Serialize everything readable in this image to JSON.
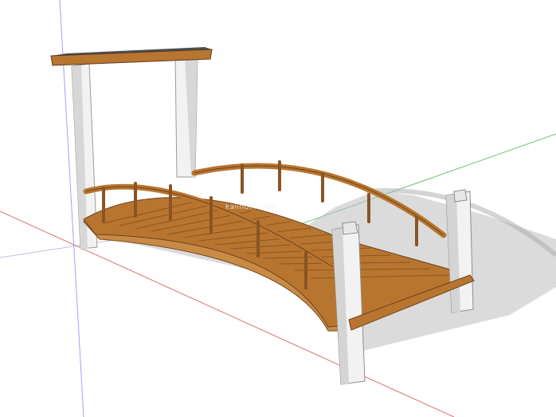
{
  "scene": {
    "watermark_text": "kalinom.com",
    "colors": {
      "background": "#ffffff",
      "wood_light": "#c88a45",
      "wood_mid": "#b8752f",
      "wood_dark": "#8a5423",
      "post_white": "#f2f2f2",
      "post_shade": "#cfcfcf",
      "shadow": "#bdbdbd",
      "axis_red": "#d85a5a",
      "axis_green": "#4caf50",
      "axis_blue": "#6a6af0"
    }
  }
}
